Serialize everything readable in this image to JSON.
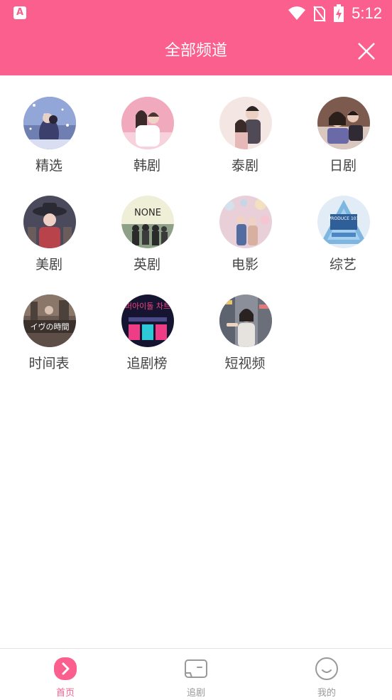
{
  "status_bar": {
    "notification_icon": "A",
    "time": "5:12",
    "icons": [
      "wifi-icon",
      "no-sim-icon",
      "battery-charging-icon"
    ]
  },
  "header": {
    "title": "全部频道",
    "close_icon": "close-icon"
  },
  "channels": [
    {
      "label": "精选",
      "thumb": "snow-couple-thumbnail"
    },
    {
      "label": "韩剧",
      "thumb": "pink-couple-thumbnail"
    },
    {
      "label": "泰剧",
      "thumb": "light-couple-thumbnail"
    },
    {
      "label": "日剧",
      "thumb": "cafe-couple-thumbnail"
    },
    {
      "label": "美剧",
      "thumb": "hat-woman-thumbnail"
    },
    {
      "label": "英剧",
      "thumb": "none-poster-thumbnail",
      "thumb_text": "NONE"
    },
    {
      "label": "电影",
      "thumb": "bokeh-couple-thumbnail"
    },
    {
      "label": "综艺",
      "thumb": "produce-101-thumbnail",
      "thumb_text": "PRODUCE 101"
    },
    {
      "label": "时间表",
      "thumb": "eve-time-thumbnail",
      "thumb_text": "イヴの時間"
    },
    {
      "label": "追剧榜",
      "thumb": "chart-show-thumbnail",
      "thumb_text": "슈퍼아이돌 차트쇼"
    },
    {
      "label": "短视频",
      "thumb": "street-woman-thumbnail"
    }
  ],
  "tab_bar": {
    "tabs": [
      {
        "label": "首页",
        "icon": "play-icon",
        "active": true
      },
      {
        "label": "追剧",
        "icon": "tv-icon",
        "active": false
      },
      {
        "label": "我的",
        "icon": "smile-icon",
        "active": false
      }
    ]
  },
  "colors": {
    "brand_pink": "#fb5f8d",
    "text": "#444444",
    "tab_inactive": "#999999"
  }
}
